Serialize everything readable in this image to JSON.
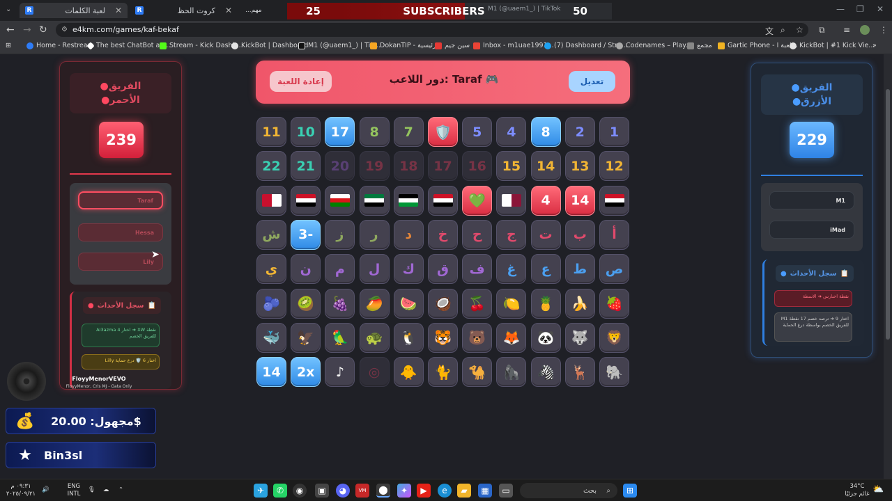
{
  "browser": {
    "tabs": [
      {
        "label": "لعبة الكلمات",
        "active": false
      },
      {
        "label": "كروت الحظ",
        "active": false
      },
      {
        "label": "...مهم",
        "active": false
      },
      {
        "label": "M1 (@uaem1_) | TikTok",
        "active": true
      }
    ],
    "subscribers_banner": {
      "left_count": "25",
      "label": "SUBSCRIBERS",
      "right_count": "50"
    },
    "url": "e4km.com/games/kaf-bekaf",
    "bookmarks": [
      "Home - Restream",
      "The best ChatBot an...",
      "Stream - Kick Dashb...",
      "KickBot | Dashboard",
      "M1 (@uaem1_) | Tik...",
      "DokanTIP - الرئيسية",
      "سين جيم",
      "Inbox - m1uae1991...",
      "(7) Dashboard / Stre...",
      "Codenames – Play...",
      "مجمع",
      "Gartic Phone - لعبة ا...",
      "KickBot | #1 Kick Vie..."
    ]
  },
  "red_team": {
    "name_line1": "الفريق",
    "name_line2": "الأحمر",
    "score": "239",
    "players": [
      "Taraf",
      "Hessa",
      "Lily"
    ],
    "log_title": "سجل الأحداث",
    "log_entries": [
      "AI3azma اختار 4 ➜ XW نقطة للفريق الخصم",
      "Lilly اختار 6 🛡️ درع حماية"
    ]
  },
  "blue_team": {
    "name_line1": "الفريق",
    "name_line2": "الأزرق",
    "score": "229",
    "players": [
      "M1",
      "iMad"
    ],
    "log_title": "سجل الأحداث",
    "log_entries": [
      "نقطة اختارس ➜ الاسطة",
      "M1 اختار 9 ➜ ترصد خصم 17 نقطة للفريق الخصم بواسطة درع الحماية"
    ]
  },
  "header": {
    "reset_label": "إعادة اللعبة",
    "turn_label": "دور اللاعب: Taraf 🎮",
    "edit_label": "تعديل"
  },
  "grid_rows": [
    [
      {
        "t": "11",
        "c": "c-yellow"
      },
      {
        "t": "10",
        "c": "c-teal"
      },
      {
        "t": "17",
        "c": "blue"
      },
      {
        "t": "8",
        "c": "c-green"
      },
      {
        "t": "7",
        "c": "c-green"
      },
      {
        "t": "🛡️",
        "c": "red emoji"
      },
      {
        "t": "5",
        "c": "c-blue"
      },
      {
        "t": "4",
        "c": "c-blue"
      },
      {
        "t": "8",
        "c": "blue"
      },
      {
        "t": "2",
        "c": "c-blue"
      },
      {
        "t": "1",
        "c": "c-blue"
      }
    ],
    [
      {
        "t": "22",
        "c": "c-teal"
      },
      {
        "t": "21",
        "c": "c-teal"
      },
      {
        "t": "20",
        "c": "c-purple dim"
      },
      {
        "t": "19",
        "c": "c-pink dim"
      },
      {
        "t": "18",
        "c": "c-pink dim"
      },
      {
        "t": "17",
        "c": "c-pink dim"
      },
      {
        "t": "16",
        "c": "c-pink dim"
      },
      {
        "t": "15",
        "c": "c-yellow"
      },
      {
        "t": "14",
        "c": "c-yellow"
      },
      {
        "t": "13",
        "c": "c-yellow"
      },
      {
        "t": "12",
        "c": "c-yellow"
      }
    ],
    [
      {
        "flag": [
          "#c8102e",
          "#ffffff"
        ],
        "dir": "row",
        "c": ""
      },
      {
        "flag": [
          "#ce1126",
          "#ffffff",
          "#000000"
        ],
        "dir": "col",
        "c": ""
      },
      {
        "flag": [
          "#ffffff",
          "#db161b",
          "#008000"
        ],
        "dir": "col",
        "c": ""
      },
      {
        "flag": [
          "#007a3d",
          "#ffffff",
          "#000000"
        ],
        "dir": "col",
        "c": ""
      },
      {
        "flag": [
          "#000000",
          "#ffffff",
          "#009736"
        ],
        "dir": "col",
        "c": ""
      },
      {
        "flag": [
          "#ce1126",
          "#ffffff",
          "#000000"
        ],
        "dir": "col",
        "c": ""
      },
      {
        "t": "💚",
        "c": "red emoji"
      },
      {
        "flag": [
          "#ffffff",
          "#8a1538"
        ],
        "dir": "row",
        "c": ""
      },
      {
        "t": "4",
        "c": "red"
      },
      {
        "t": "14",
        "c": "red"
      },
      {
        "flag": [
          "#ce1126",
          "#ffffff",
          "#000000"
        ],
        "dir": "col",
        "c": ""
      }
    ],
    [
      {
        "t": "ش",
        "c": "c-grn2"
      },
      {
        "t": "3-",
        "c": "blue"
      },
      {
        "t": "ز",
        "c": "c-grn2"
      },
      {
        "t": "ر",
        "c": "c-grn2"
      },
      {
        "t": "د",
        "c": "c-orange"
      },
      {
        "t": "خ",
        "c": "c-pink"
      },
      {
        "t": "ح",
        "c": "c-pink"
      },
      {
        "t": "ج",
        "c": "c-pink"
      },
      {
        "t": "ت",
        "c": "c-pink"
      },
      {
        "t": "ب",
        "c": "c-pink"
      },
      {
        "t": "أ",
        "c": "c-pink"
      }
    ],
    [
      {
        "t": "ي",
        "c": "c-yellow"
      },
      {
        "t": "ن",
        "c": "c-purple"
      },
      {
        "t": "م",
        "c": "c-purple"
      },
      {
        "t": "ل",
        "c": "c-purple"
      },
      {
        "t": "ك",
        "c": "c-purple"
      },
      {
        "t": "ق",
        "c": "c-purple"
      },
      {
        "t": "ف",
        "c": "c-purple"
      },
      {
        "t": "غ",
        "c": "c-lblue"
      },
      {
        "t": "ع",
        "c": "c-lblue"
      },
      {
        "t": "ط",
        "c": "c-lblue"
      },
      {
        "t": "ص",
        "c": "c-lblue"
      }
    ],
    [
      {
        "t": "🫐",
        "c": "emoji"
      },
      {
        "t": "🥝",
        "c": "emoji"
      },
      {
        "t": "🍇",
        "c": "emoji"
      },
      {
        "t": "🥭",
        "c": "emoji"
      },
      {
        "t": "🍉",
        "c": "emoji"
      },
      {
        "t": "🥥",
        "c": "emoji"
      },
      {
        "t": "🍒",
        "c": "emoji"
      },
      {
        "t": "🍋",
        "c": "emoji"
      },
      {
        "t": "🍍",
        "c": "emoji"
      },
      {
        "t": "🍌",
        "c": "emoji"
      },
      {
        "t": "🍓",
        "c": "emoji"
      }
    ],
    [
      {
        "t": "🐳",
        "c": "emoji"
      },
      {
        "t": "🦅",
        "c": "emoji"
      },
      {
        "t": "🦜",
        "c": "emoji"
      },
      {
        "t": "🐢",
        "c": "emoji"
      },
      {
        "t": "🐧",
        "c": "emoji"
      },
      {
        "t": "🐯",
        "c": "emoji"
      },
      {
        "t": "🐻",
        "c": "emoji"
      },
      {
        "t": "🦊",
        "c": "emoji"
      },
      {
        "t": "🐼",
        "c": "emoji"
      },
      {
        "t": "🐺",
        "c": "emoji"
      },
      {
        "t": "🦁",
        "c": "emoji"
      }
    ],
    [
      {
        "t": "14",
        "c": "blue"
      },
      {
        "t": "2x",
        "c": "blue c-white"
      },
      {
        "t": "♪",
        "c": "c-white"
      },
      {
        "t": "◎",
        "c": "c-pink dim"
      },
      {
        "t": "🐥",
        "c": "emoji"
      },
      {
        "t": "🐈",
        "c": "emoji"
      },
      {
        "t": "🐪",
        "c": "emoji"
      },
      {
        "t": "🦍",
        "c": "emoji"
      },
      {
        "t": "🦓",
        "c": "emoji"
      },
      {
        "t": "🦌",
        "c": "emoji"
      },
      {
        "t": "🐘",
        "c": "emoji"
      }
    ]
  ],
  "overlays": {
    "music_title": "FloyyMenorVEVO",
    "music_artist": "FloyyMenor, Cris MJ - Gata Only",
    "donation_text": "مجهول: 20.00$",
    "follower_text": "Bin3sl"
  },
  "taskbar": {
    "search_placeholder": "بحث",
    "lang_line1": "ENG",
    "lang_line2": "INTL",
    "time": "٠٩:٣١ م",
    "date": "٢٠٢٥/٠٩/٢١",
    "weather_temp": "34°C",
    "weather_desc": "غائم جزئيًا"
  }
}
